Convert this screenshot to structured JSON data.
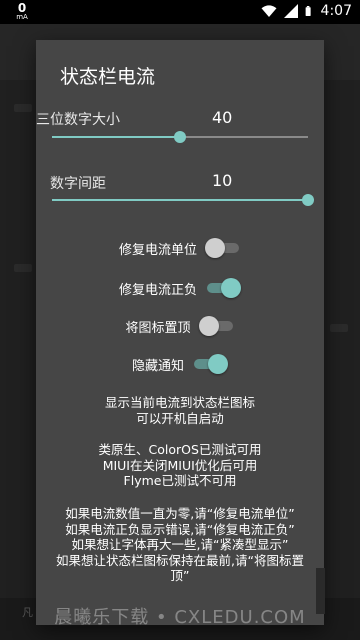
{
  "status_bar": {
    "net_speed": "0",
    "net_unit": "mA",
    "time": "4:07",
    "icons": [
      "wifi-icon",
      "signal-icon",
      "battery-icon"
    ]
  },
  "background_app": {
    "bottom_text": "凡"
  },
  "dialog": {
    "title": "状态栏电流",
    "sliders": [
      {
        "label": "三位数字大小",
        "value": "40",
        "level": 0.5
      },
      {
        "label": "数字间距",
        "value": "10",
        "level": 1.0
      }
    ],
    "switches": [
      {
        "label": "修复电流单位",
        "checked": false
      },
      {
        "label": "修复电流正负",
        "checked": true
      },
      {
        "label": "将图标置顶",
        "checked": false
      },
      {
        "label": "隐藏通知",
        "checked": true
      }
    ],
    "info_1": [
      "显示当前电流到状态栏图标",
      "可以开机自启动"
    ],
    "info_2": [
      "类原生、ColorOS已测试可用",
      "MIUI在关闭MIUI优化后可用",
      "Flyme已测试不可用"
    ],
    "info_3": [
      "如果电流数值一直为零,请“修复电流单位”",
      "如果电流正负显示错误,请“修复电流正负”",
      "如果想让字体再大一些,请“紧凑型显示”",
      "如果想让状态栏图标保持在最前,请“将图标置",
      "顶”"
    ]
  },
  "watermark": "晨曦乐下载 • CXLEDU.COM",
  "colors": {
    "accent": "#80cbc4",
    "dialog_bg": "#464646",
    "status_bar_bg": "#000000"
  }
}
